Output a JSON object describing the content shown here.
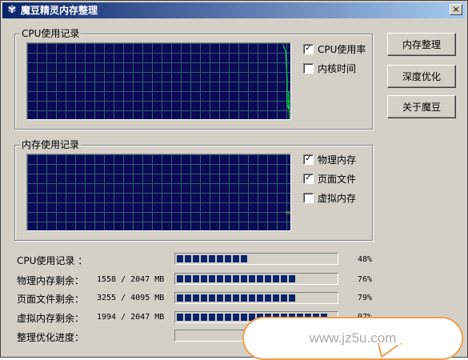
{
  "window": {
    "title": "魔豆精灵内存整理",
    "close_label": "×"
  },
  "cpu_group": {
    "label": "CPU使用记录",
    "checkboxes": [
      {
        "label": "CPU使用率",
        "checked": true
      },
      {
        "label": "内核时间",
        "checked": false
      }
    ]
  },
  "mem_group": {
    "label": "内存使用记录",
    "checkboxes": [
      {
        "label": "物理内存",
        "checked": true
      },
      {
        "label": "页面文件",
        "checked": true
      },
      {
        "label": "虚拟内存",
        "checked": false
      }
    ]
  },
  "buttons": {
    "cleanup": "内存整理",
    "deep_optimize": "深度优化",
    "about": "关于魔豆"
  },
  "stats": [
    {
      "label": "CPU使用记录 ：",
      "value": "",
      "percent": 48,
      "pct_label": "48%"
    },
    {
      "label": "物理内存剩余：",
      "value": "1558 / 2047 MB",
      "percent": 76,
      "pct_label": "76%"
    },
    {
      "label": "页面文件剩余：",
      "value": "3255 / 4095 MB",
      "percent": 79,
      "pct_label": "79%"
    },
    {
      "label": "虚拟内存剩余：",
      "value": "1994 / 2047 MB",
      "percent": 97,
      "pct_label": "97%"
    },
    {
      "label": "整理优化进度：",
      "value": "",
      "percent": 0,
      "pct_label": ""
    }
  ],
  "watermark": "www.jz5u.com",
  "colors": {
    "graph_bg": "#0a0a55",
    "grid": "#2f5f70",
    "cpu_line": "#00ff40",
    "bar_fill": "#0a246a",
    "title_start": "#0a246a"
  }
}
